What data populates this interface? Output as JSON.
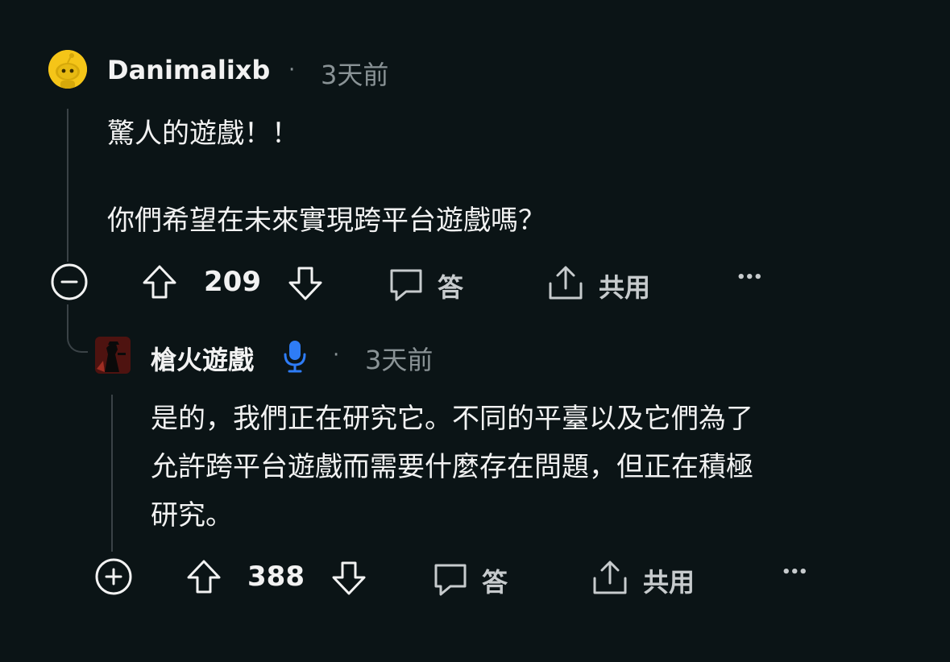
{
  "comments": [
    {
      "username": "Danimalixb",
      "separator": "·",
      "time": "3天前",
      "lines": [
        "驚人的遊戲！！",
        "你們希望在未來實現跨平台遊戲嗎？"
      ],
      "score": "209",
      "reply_label": "答",
      "share_label": "共用",
      "more_label": "•••",
      "collapse_icon": "minus-circle-icon"
    },
    {
      "username": "槍火遊戲",
      "badge_icon": "microphone-icon",
      "separator": "·",
      "time": "3天前",
      "lines": [
        "是的，我們正在研究它。不同的平臺以及它們為了",
        "允許跨平台遊戲而需要什麼存在問題，但正在積極",
        "研究。"
      ],
      "score": "388",
      "reply_label": "答",
      "share_label": "共用",
      "more_label": "•••",
      "expand_icon": "plus-circle-icon"
    }
  ],
  "colors": {
    "background": "#0b1416",
    "text": "#f2f2f2",
    "muted": "#8a9396",
    "badge_blue": "#2e7cf6",
    "avatar_yellow": "#f5c518"
  }
}
